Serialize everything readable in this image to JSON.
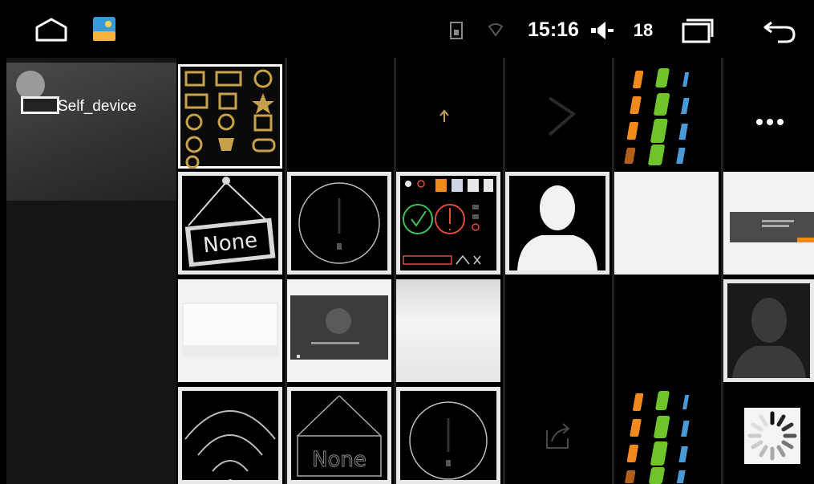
{
  "status_bar": {
    "time": "15:16",
    "volume_level": "18",
    "icons": [
      "home-icon",
      "gallery-app-icon",
      "sd-card-icon",
      "wifi-icon",
      "volume-icon",
      "recent-apps-icon",
      "back-icon"
    ]
  },
  "sidebar": {
    "items": [
      {
        "label": "Self_device",
        "icon": "device-folder-icon"
      }
    ]
  },
  "grid": {
    "thumbnails": [
      {
        "name": "media-icons-sprite"
      },
      {
        "name": "dark-blank"
      },
      {
        "name": "dark-arrow"
      },
      {
        "name": "dark-chevron"
      },
      {
        "name": "color-bars"
      },
      {
        "name": "more-dots"
      },
      {
        "name": "none-sign",
        "text": "None"
      },
      {
        "name": "circle-exclamation"
      },
      {
        "name": "check-error-sprite"
      },
      {
        "name": "person-silhouette"
      },
      {
        "name": "white-blank"
      },
      {
        "name": "dialog-screenshot"
      },
      {
        "name": "white-card"
      },
      {
        "name": "dark-dialog"
      },
      {
        "name": "gray-gradient"
      },
      {
        "name": "dark-blank-2"
      },
      {
        "name": "dark-blank-3"
      },
      {
        "name": "avatar-dark"
      },
      {
        "name": "wifi-arcs"
      },
      {
        "name": "none-sign-dim",
        "text": "None"
      },
      {
        "name": "circle-exclamation-2"
      },
      {
        "name": "share-icon"
      },
      {
        "name": "color-bars-2"
      },
      {
        "name": "loading-spinner"
      }
    ]
  },
  "colors": {
    "orange": "#f08a1e",
    "green": "#6fc42b",
    "blue": "#4a9ad8",
    "gold": "#c8a24a",
    "red": "#e04b3a",
    "check_green": "#3fbf5a"
  }
}
